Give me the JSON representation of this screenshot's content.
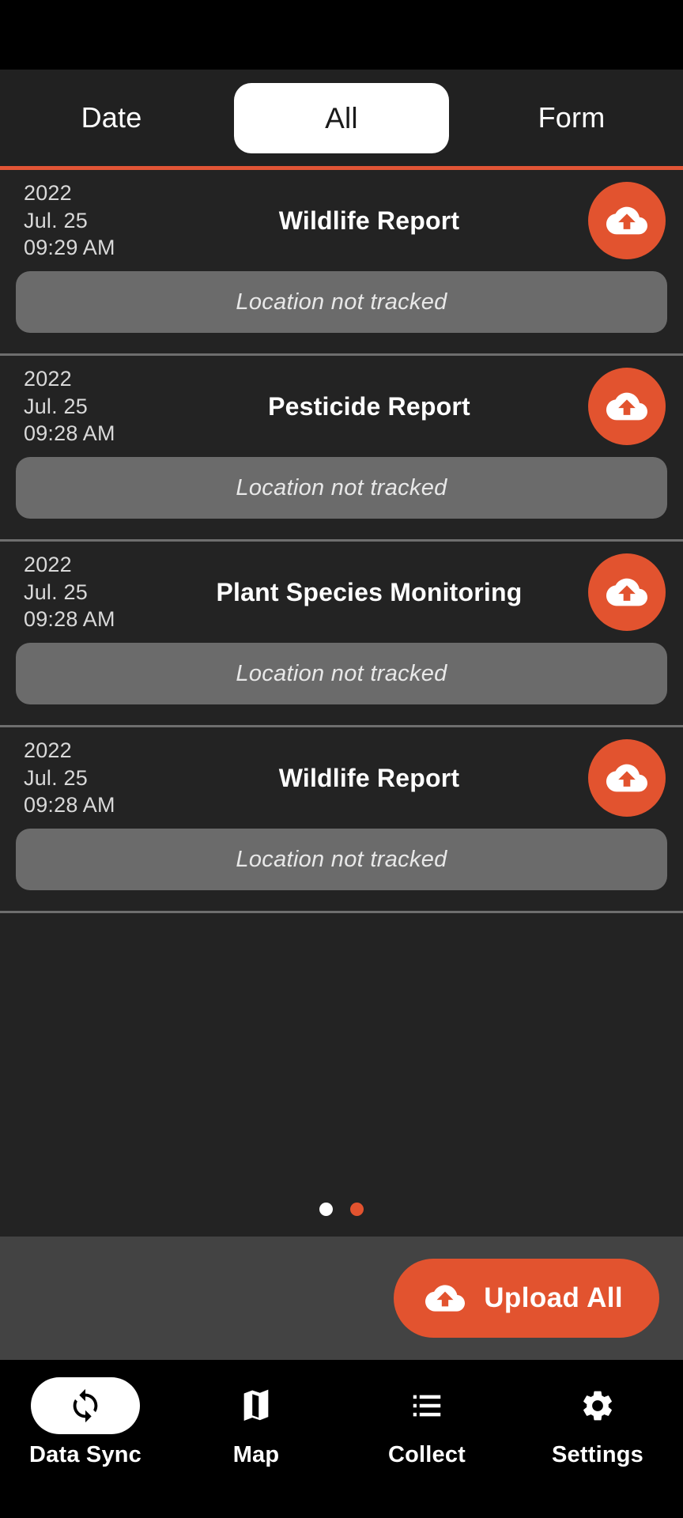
{
  "filter_tabs": [
    {
      "label": "Date",
      "active": false
    },
    {
      "label": "All",
      "active": true
    },
    {
      "label": "Form",
      "active": false
    }
  ],
  "accent_color": "#E2532F",
  "records": [
    {
      "year": "2022",
      "date": "Jul. 25",
      "time": "09:29 AM",
      "title": "Wildlife Report",
      "location": "Location not tracked",
      "upload_icon": "cloud-upload-icon"
    },
    {
      "year": "2022",
      "date": "Jul. 25",
      "time": "09:28 AM",
      "title": "Pesticide Report",
      "location": "Location not tracked",
      "upload_icon": "cloud-upload-icon"
    },
    {
      "year": "2022",
      "date": "Jul. 25",
      "time": "09:28 AM",
      "title": "Plant Species Monitoring",
      "location": "Location not tracked",
      "upload_icon": "cloud-upload-icon"
    },
    {
      "year": "2022",
      "date": "Jul. 25",
      "time": "09:28 AM",
      "title": "Wildlife Report",
      "location": "Location not tracked",
      "upload_icon": "cloud-upload-icon"
    }
  ],
  "pager": {
    "dots": [
      {
        "color": "#FFFFFF",
        "active": true
      },
      {
        "color": "#E2532F",
        "active": false
      }
    ]
  },
  "footer": {
    "upload_all_label": "Upload All",
    "upload_all_icon": "cloud-upload-icon"
  },
  "bottom_nav": [
    {
      "label": "Data Sync",
      "icon": "sync-icon",
      "active": true
    },
    {
      "label": "Map",
      "icon": "map-icon",
      "active": false
    },
    {
      "label": "Collect",
      "icon": "list-icon",
      "active": false
    },
    {
      "label": "Settings",
      "icon": "gear-icon",
      "active": false
    }
  ]
}
